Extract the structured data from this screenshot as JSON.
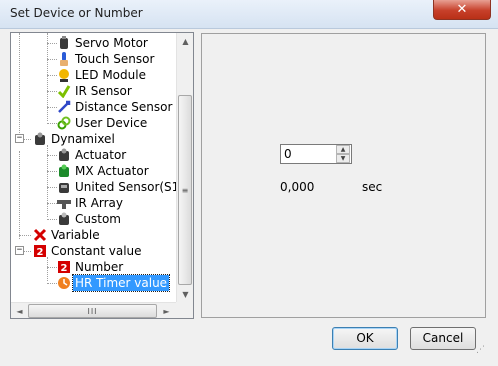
{
  "window": {
    "title": "Set Device or Number",
    "close_glyph": "✕"
  },
  "tree": {
    "items": [
      {
        "label": "Servo Motor",
        "icon": "servo-motor-icon",
        "color": "#3a3a3a"
      },
      {
        "label": "Touch Sensor",
        "icon": "touch-sensor-icon",
        "color": "#2a5bd7"
      },
      {
        "label": "LED Module",
        "icon": "led-module-icon",
        "color": "#f2b600"
      },
      {
        "label": "IR Sensor",
        "icon": "ir-sensor-icon",
        "color": "#7cc000"
      },
      {
        "label": "Distance Sensor",
        "icon": "distance-sensor-icon",
        "color": "#3048c8"
      },
      {
        "label": "User Device",
        "icon": "user-device-icon",
        "color": "#3aa000"
      },
      {
        "label": "Dynamixel",
        "icon": "dynamixel-icon",
        "color": "#3a3a3a",
        "expander": "−"
      },
      {
        "label": "Actuator",
        "icon": "actuator-icon",
        "color": "#3a3a3a"
      },
      {
        "label": "MX Actuator",
        "icon": "mx-actuator-icon",
        "color": "#1b8a2a"
      },
      {
        "label": "United Sensor(S1)",
        "icon": "united-sensor-icon",
        "color": "#3a3a3a"
      },
      {
        "label": "IR Array",
        "icon": "ir-array-icon",
        "color": "#555555"
      },
      {
        "label": "Custom",
        "icon": "custom-icon",
        "color": "#3a3a3a"
      },
      {
        "label": "Variable",
        "icon": "variable-icon",
        "color": "#d40000"
      },
      {
        "label": "Constant value",
        "icon": "constant-value-icon",
        "color": "#d40000",
        "expander": "−"
      },
      {
        "label": "Number",
        "icon": "number-icon",
        "color": "#d40000"
      },
      {
        "label": "HR Timer value",
        "icon": "timer-icon",
        "color": "#f08020",
        "selected": true
      }
    ],
    "vscroll": {
      "up": "▲",
      "down": "▼",
      "thumb_grip": "≡"
    },
    "hscroll": {
      "left": "◄",
      "right": "►",
      "thumb_grip": "III"
    }
  },
  "panel": {
    "spin_value": "0",
    "spin_up": "▲",
    "spin_down": "▼",
    "readout_value": "0,000",
    "readout_unit": "sec"
  },
  "buttons": {
    "ok": "OK",
    "cancel": "Cancel"
  },
  "colors": {
    "selection": "#3399ff",
    "close_button": "#c7402a"
  }
}
